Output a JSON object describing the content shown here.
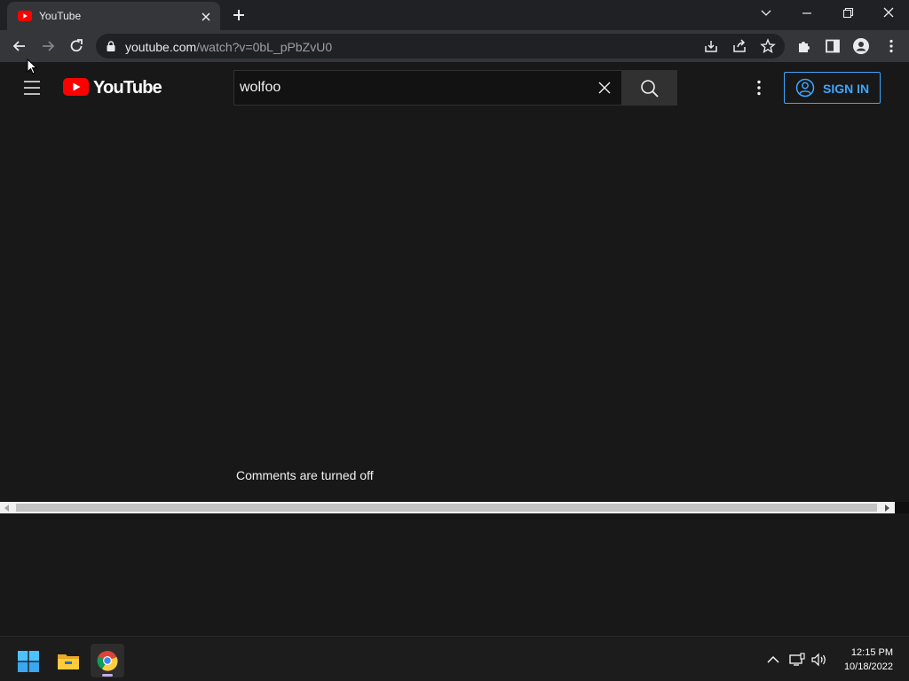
{
  "browser": {
    "tab": {
      "title": "YouTube"
    },
    "address": {
      "host": "youtube.com",
      "path": "/watch?v=0bL_pPbZvU0"
    }
  },
  "youtube": {
    "logo_text": "YouTube",
    "search": {
      "value": "wolfoo"
    },
    "sign_in_label": "SIGN IN",
    "comments_status": "Comments are turned off"
  },
  "taskbar": {
    "time": "12:15 PM",
    "date": "10/18/2022"
  },
  "colors": {
    "accent_blue": "#3ea6ff",
    "yt_red": "#ff0000",
    "page_bg": "#181818"
  }
}
